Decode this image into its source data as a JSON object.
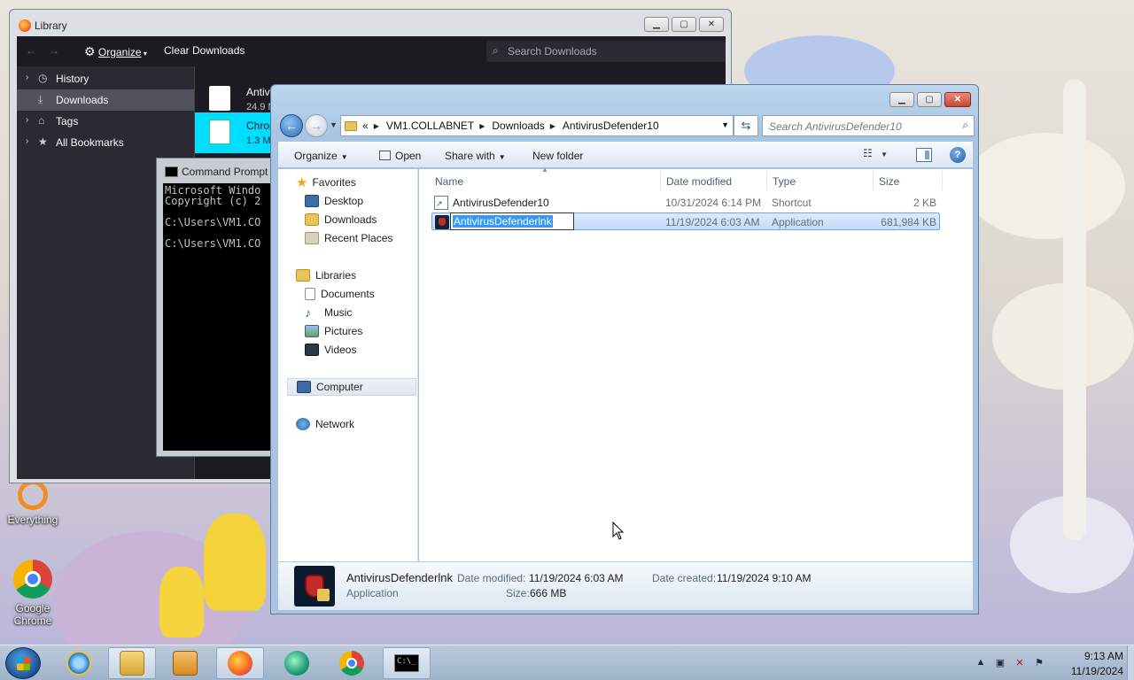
{
  "desktop": {
    "icons": [
      {
        "label": "Everything"
      },
      {
        "label": "Google Chrome"
      }
    ]
  },
  "library": {
    "title": "Library",
    "toolbar": {
      "organize": "Organize",
      "clear_downloads": "Clear Downloads",
      "search_placeholder": "Search Downloads"
    },
    "sidebar": [
      {
        "label": "History"
      },
      {
        "label": "Downloads"
      },
      {
        "label": "Tags"
      },
      {
        "label": "All Bookmarks"
      }
    ],
    "downloads": [
      {
        "name": "AntivirusDefender10.7z",
        "size": "24.9 MB"
      },
      {
        "name": "Chrom",
        "size": "1.3 M"
      }
    ]
  },
  "cmd": {
    "title": "Command Prompt",
    "lines": "Microsoft Windo\nCopyright (c) 2\n\nC:\\Users\\VM1.CO\n\nC:\\Users\\VM1.CO"
  },
  "explorer": {
    "address": {
      "overflow": "«",
      "segments": [
        "VM1.COLLABNET",
        "Downloads",
        "AntivirusDefender10"
      ]
    },
    "search_placeholder": "Search AntivirusDefender10",
    "commandbar": {
      "organize": "Organize",
      "open": "Open",
      "share_with": "Share with",
      "new_folder": "New folder"
    },
    "nav": {
      "favorites": "Favorites",
      "desktop": "Desktop",
      "downloads": "Downloads",
      "recent_places": "Recent Places",
      "libraries": "Libraries",
      "documents": "Documents",
      "music": "Music",
      "pictures": "Pictures",
      "videos": "Videos",
      "computer": "Computer",
      "network": "Network"
    },
    "columns": {
      "name": "Name",
      "date_modified": "Date modified",
      "type": "Type",
      "size": "Size"
    },
    "files": [
      {
        "name": "AntivirusDefender10",
        "date": "10/31/2024 6:14 PM",
        "type": "Shortcut",
        "size": "2 KB"
      },
      {
        "name": "AntivirusDefenderlnk",
        "date": "11/19/2024 6:03 AM",
        "type": "Application",
        "size": "681,984 KB"
      }
    ],
    "details": {
      "name": "AntivirusDefenderlnk",
      "type": "Application",
      "modified_label": "Date modified:",
      "modified_value": "11/19/2024 6:03 AM",
      "created_label": "Date created:",
      "created_value": "11/19/2024 9:10 AM",
      "size_label": "Size:",
      "size_value": "666 MB"
    }
  },
  "taskbar": {
    "time": "9:13 AM",
    "date": "11/19/2024",
    "apps": [
      "internet-explorer",
      "file-explorer",
      "media-player",
      "firefox",
      "app-green",
      "chrome",
      "command-prompt"
    ]
  }
}
